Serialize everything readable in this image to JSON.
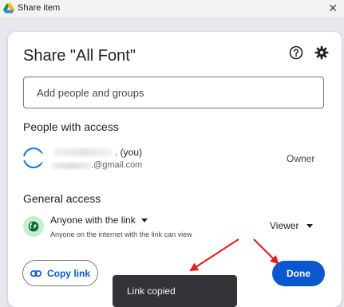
{
  "window": {
    "title": "Share item",
    "close_glyph": "✕",
    "logo_icon": "google-drive-icon"
  },
  "dialog": {
    "title": "Share \"All Font\"",
    "help_icon": "help-icon",
    "settings_icon": "gear-icon",
    "add_people_placeholder": "Add people and groups",
    "people_section_title": "People with access",
    "owner": {
      "name_suffix": ". (you)",
      "email_suffix": ".@gmail.com",
      "role": "Owner"
    },
    "general_section_title": "General access",
    "general_access": {
      "scope": "Anyone with the link",
      "description": "Anyone on the internet with the link can view",
      "role": "Viewer",
      "icon": "globe-icon"
    },
    "copy_link_label": "Copy link",
    "done_label": "Done"
  },
  "toast": {
    "message": "Link copied"
  },
  "colors": {
    "primary": "#0b57d0",
    "globe_bg": "#c4eed0",
    "toast_bg": "#333438",
    "annotation_arrow": "#e02020"
  }
}
